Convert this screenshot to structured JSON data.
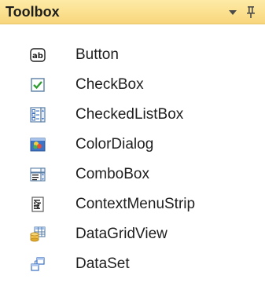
{
  "toolbox": {
    "title": "Toolbox",
    "items": [
      {
        "label": "Button",
        "icon": "button-icon"
      },
      {
        "label": "CheckBox",
        "icon": "checkbox-icon"
      },
      {
        "label": "CheckedListBox",
        "icon": "checked-list-box-icon"
      },
      {
        "label": "ColorDialog",
        "icon": "color-dialog-icon"
      },
      {
        "label": "ComboBox",
        "icon": "combo-box-icon"
      },
      {
        "label": "ContextMenuStrip",
        "icon": "context-menu-strip-icon"
      },
      {
        "label": "DataGridView",
        "icon": "data-grid-view-icon"
      },
      {
        "label": "DataSet",
        "icon": "dataset-icon"
      }
    ]
  },
  "icons": {
    "button_icon_text": "ab"
  },
  "colors": {
    "title_bar": "#fbe08f",
    "title_bar_border": "#e8c569",
    "text": "#1e1e1e",
    "check_green": "#2e9c2e",
    "icon_blue": "#3b6fc2"
  }
}
